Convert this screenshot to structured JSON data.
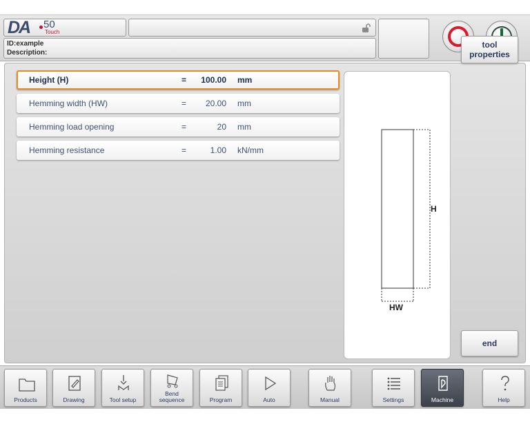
{
  "header": {
    "logo_brand": "DA",
    "logo_model": "50",
    "logo_sub": "Touch",
    "id_line": "ID:example",
    "description_line": "Description:"
  },
  "params": [
    {
      "label": "Height (H)",
      "eq": "=",
      "value": "100.00",
      "unit": "mm",
      "selected": true
    },
    {
      "label": "Hemming width (HW)",
      "eq": "=",
      "value": "20.00",
      "unit": "mm",
      "selected": false
    },
    {
      "label": "Hemming load opening",
      "eq": "=",
      "value": "20",
      "unit": "mm",
      "selected": false
    },
    {
      "label": "Hemming resistance",
      "eq": "=",
      "value": "1.00",
      "unit": "kN/mm",
      "selected": false
    }
  ],
  "drawing": {
    "height_label": "H",
    "width_label": "HW"
  },
  "side_buttons": {
    "tool_properties_line1": "tool",
    "tool_properties_line2": "properties",
    "end": "end"
  },
  "nav": [
    {
      "label": "Products",
      "icon": "folder-icon",
      "active": false
    },
    {
      "label": "Drawing",
      "icon": "drawing-pencil-icon",
      "active": false
    },
    {
      "label": "Tool setup",
      "icon": "punch-die-icon",
      "active": false
    },
    {
      "label": "Bend sequence",
      "icon": "bend-sequence-icon",
      "active": false
    },
    {
      "label": "Program",
      "icon": "program-pages-icon",
      "active": false
    },
    {
      "label": "Auto",
      "icon": "play-icon",
      "active": false
    },
    {
      "label": "Manual",
      "icon": "hand-icon",
      "active": false
    },
    {
      "label": "Settings",
      "icon": "settings-list-icon",
      "active": false
    },
    {
      "label": "Machine",
      "icon": "machine-icon",
      "active": true
    },
    {
      "label": "Help",
      "icon": "question-icon",
      "active": false
    }
  ],
  "colors": {
    "selected_border": "#e98b1e",
    "stop_red": "#d41c2b",
    "start_green": "#0f6a3c",
    "text_blue": "#3f4f72"
  }
}
